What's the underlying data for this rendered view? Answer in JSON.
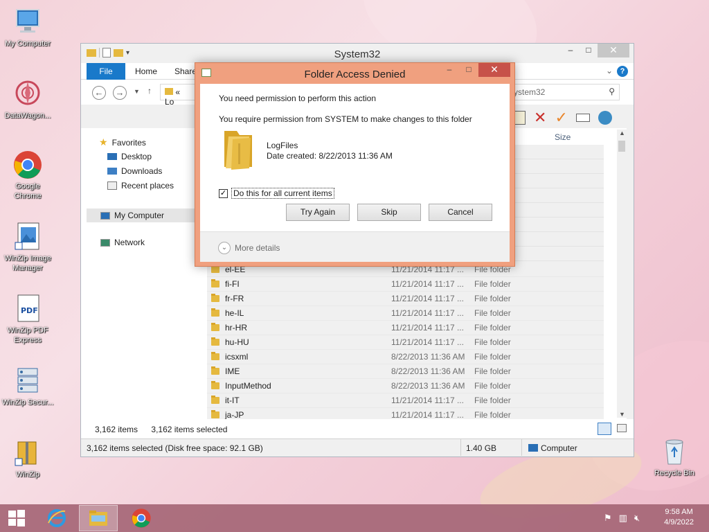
{
  "desktop": {
    "icons": [
      {
        "label": "My Computer",
        "icon": "my-computer-icon"
      },
      {
        "label": "DataWagon...",
        "icon": "datawagon-icon"
      },
      {
        "label": "Google Chrome",
        "icon": "chrome-icon"
      },
      {
        "label": "WinZip Image Manager",
        "icon": "winzip-image-icon"
      },
      {
        "label": "WinZip PDF Express",
        "icon": "winzip-pdf-icon"
      },
      {
        "label": "WinZip Secur...",
        "icon": "winzip-secure-icon"
      },
      {
        "label": "WinZip",
        "icon": "winzip-icon"
      }
    ],
    "recycle_bin": "Recycle Bin"
  },
  "explorer": {
    "title": "System32",
    "tabs": {
      "file": "File",
      "home": "Home",
      "share": "Share"
    },
    "address_prefix": "«",
    "address_text": "Lo",
    "search_placeholder": "ystem32",
    "column_size": "Size",
    "nav": {
      "favorites": "Favorites",
      "desktop": "Desktop",
      "downloads": "Downloads",
      "recent": "Recent places",
      "computer": "My Computer",
      "network": "Network"
    },
    "rows": [
      {
        "name": "el-EE",
        "date": "11/21/2014 11:17 ...",
        "type": "File folder"
      },
      {
        "name": "fi-FI",
        "date": "11/21/2014 11:17 ...",
        "type": "File folder"
      },
      {
        "name": "fr-FR",
        "date": "11/21/2014 11:17 ...",
        "type": "File folder"
      },
      {
        "name": "he-IL",
        "date": "11/21/2014 11:17 ...",
        "type": "File folder"
      },
      {
        "name": "hr-HR",
        "date": "11/21/2014 11:17 ...",
        "type": "File folder"
      },
      {
        "name": "hu-HU",
        "date": "11/21/2014 11:17 ...",
        "type": "File folder"
      },
      {
        "name": "icsxml",
        "date": "8/22/2013 11:36 AM",
        "type": "File folder"
      },
      {
        "name": "IME",
        "date": "8/22/2013 11:36 AM",
        "type": "File folder"
      },
      {
        "name": "InputMethod",
        "date": "8/22/2013 11:36 AM",
        "type": "File folder"
      },
      {
        "name": "it-IT",
        "date": "11/21/2014 11:17 ...",
        "type": "File folder"
      },
      {
        "name": "ja-JP",
        "date": "11/21/2014 11:17 ...",
        "type": "File folder"
      }
    ],
    "status": {
      "items": "3,162 items",
      "selected": "3,162 items selected",
      "bottom": "3,162 items selected (Disk free space: 92.1 GB)",
      "size": "1.40 GB",
      "location": "Computer"
    }
  },
  "dialog": {
    "title": "Folder Access Denied",
    "line1": "You need permission to perform this action",
    "line2": "You require permission from SYSTEM to make changes to this folder",
    "folder_name": "LogFiles",
    "folder_date": "Date created: 8/22/2013 11:36 AM",
    "checkbox_label": "Do this for all current items",
    "checkbox_checked": true,
    "buttons": {
      "try_again": "Try Again",
      "skip": "Skip",
      "cancel": "Cancel"
    },
    "more_details": "More details"
  },
  "taskbar": {
    "time": "9:58 AM",
    "date": "4/9/2022"
  }
}
